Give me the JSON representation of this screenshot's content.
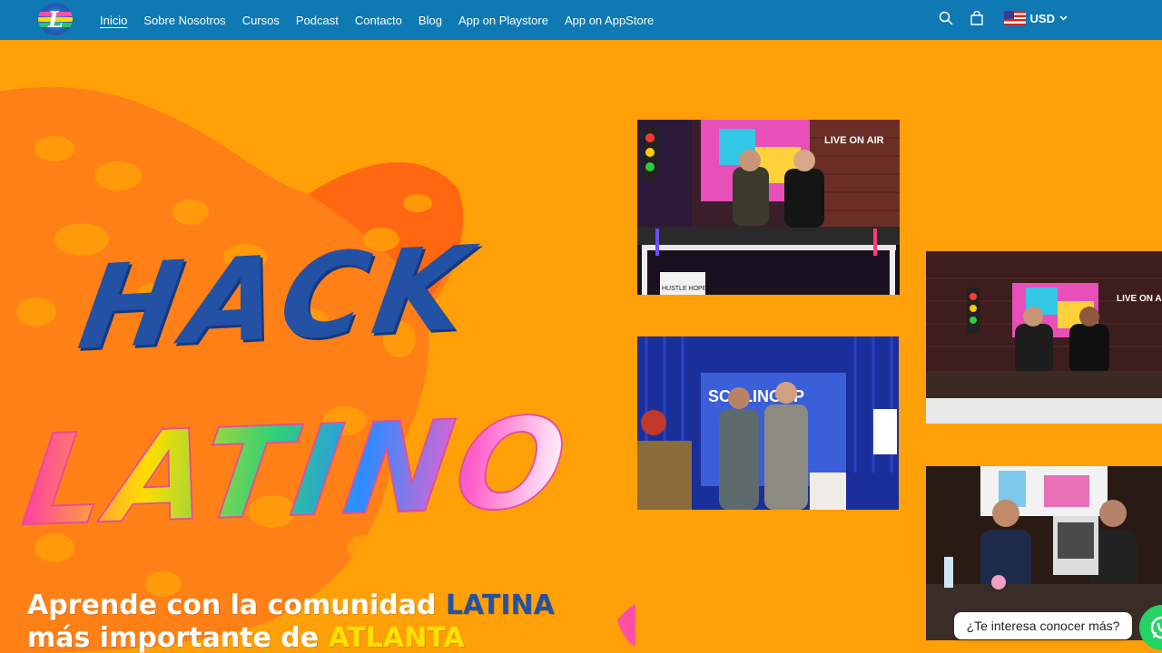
{
  "header": {
    "logo_letter": "L",
    "nav": [
      {
        "label": "Inicio",
        "active": true
      },
      {
        "label": "Sobre Nosotros",
        "active": false
      },
      {
        "label": "Cursos",
        "active": false
      },
      {
        "label": "Podcast",
        "active": false
      },
      {
        "label": "Contacto",
        "active": false
      },
      {
        "label": "Blog",
        "active": false
      },
      {
        "label": "App on Playstore",
        "active": false
      },
      {
        "label": "App on AppStore",
        "active": false
      }
    ],
    "icons": [
      "search-icon",
      "cart-icon"
    ],
    "currency": "USD"
  },
  "hero": {
    "title_line1": "HACK",
    "title_line2": "LATINO",
    "tagline_line1_prefix": "Aprende con la comunidad ",
    "tagline_line1_highlight": "LATINA",
    "tagline_line2_prefix": "más importante de ",
    "tagline_line2_highlight": "ATLANTA"
  },
  "photos": {
    "photo1_sign": "LIVE ON AIR",
    "photo1_mug": "HUSTLE HOPE",
    "photo2_sign": "LIVE ON AIR",
    "photo3_sign": "SCALINGUP"
  },
  "chat": {
    "bubble_text": "¿Te interesa conocer más?"
  },
  "colors": {
    "header_bg": "#0E79B2",
    "page_bg": "#FFA008",
    "title_blue": "#2352A5",
    "whatsapp_green": "#25D366"
  }
}
